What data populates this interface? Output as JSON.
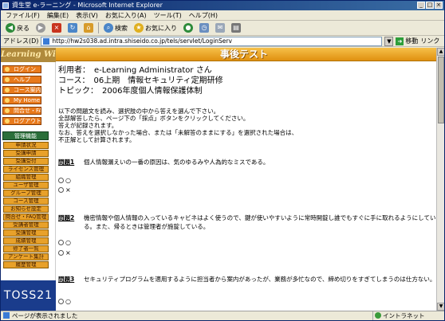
{
  "window": {
    "title": "資生堂 e-ラーニング - Microsoft Internet Explorer"
  },
  "menu": [
    "ファイル(F)",
    "編集(E)",
    "表示(V)",
    "お気に入り(A)",
    "ツール(T)",
    "ヘルプ(H)"
  ],
  "toolbar": {
    "back": "戻る",
    "search": "検索",
    "favorites": "お気に入り"
  },
  "address": {
    "label": "アドレス(D)",
    "url": "http://hw2s038.ad.intra.shiseido.co.jp/tels/servlet/LoginServ",
    "go": "移動",
    "links": "リンク"
  },
  "sidebar": {
    "logo": "Learning Wind",
    "menu": [
      "ログイン",
      "ヘルプ",
      "コース案内",
      "My Home",
      "問合せ・FAQ",
      "ログアウト"
    ],
    "manager_heading": "管理機能",
    "manager_items": [
      "申請状況",
      "受講申請",
      "受講受付",
      "ライセンス管理",
      "組織管理",
      "ユーザ管理",
      "グループ管理",
      "コース管理",
      "お知らせ設定",
      "問合せ・FAQ管理",
      "受講者管理",
      "受講管理",
      "成績管理",
      "修了者一覧",
      "アンケート集計",
      "履歴管理"
    ],
    "brand": "TOSS21"
  },
  "page": {
    "heading": "事後テスト",
    "info": [
      {
        "label": "利用者：",
        "value": "e-Learning Administrator さん"
      },
      {
        "label": "コース：",
        "value": "06上期　情報セキュリティ定期研修"
      },
      {
        "label": "トピック：",
        "value": "2006年度個人情報保護体制"
      }
    ],
    "instructions": [
      "以下の問題文を読み、選択肢の中から答えを選んで下さい。",
      "全部解答したら、ページ下の「採点」ボタンをクリックしてください。",
      "答えが記録されます。",
      "なお、答えを選択しなかった場合、または「未解答のままにする」を選択された場合は、",
      "不正解として計算されます。"
    ],
    "questions": [
      {
        "label": "問題1",
        "text": "個人情報漏えいの一番の原因は、気のゆるみや人為的なミスである。",
        "options": [
          "○",
          "×"
        ]
      },
      {
        "label": "問題2",
        "text": "機密情報や個人情報の入っているキャビネはよく使うので、鍵が使いやすいように常時開錠し誰でもすぐに手に取れるようにしている。また、帰るときは管理者が施錠している。",
        "options": [
          "○",
          "×"
        ]
      },
      {
        "label": "問題3",
        "text": "セキュリティプログラムを適用するように担当者から案内があったが、業務が多忙なので、締め切りをすぎてしまうのは仕方ない。",
        "options": [
          "○"
        ]
      }
    ]
  },
  "status": {
    "left": "ページが表示されました",
    "right": "イントラネット"
  }
}
